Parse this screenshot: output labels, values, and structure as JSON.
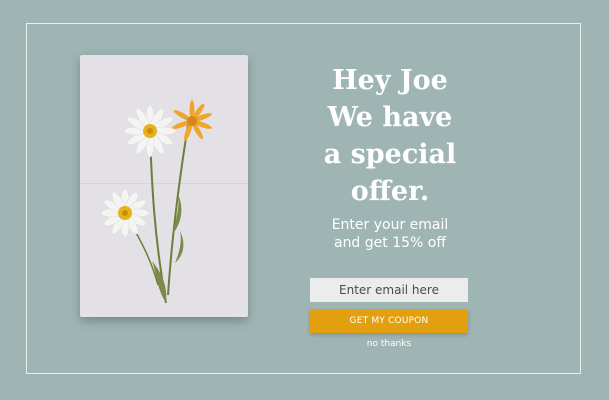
{
  "popup": {
    "headline_lines": [
      "Hey Joe",
      "We have",
      "a special",
      "offer."
    ],
    "subtitle_lines": [
      "Enter your email",
      "and get 15% off"
    ],
    "email_placeholder": "Enter email here",
    "cta_label": "GET MY COUPON",
    "dismiss_label": "no thanks"
  },
  "colors": {
    "background": "#9fb5b4",
    "accent": "#e2a010",
    "frame": "#e6eeee"
  },
  "image": {
    "icon": "pressed-daisy-image"
  }
}
